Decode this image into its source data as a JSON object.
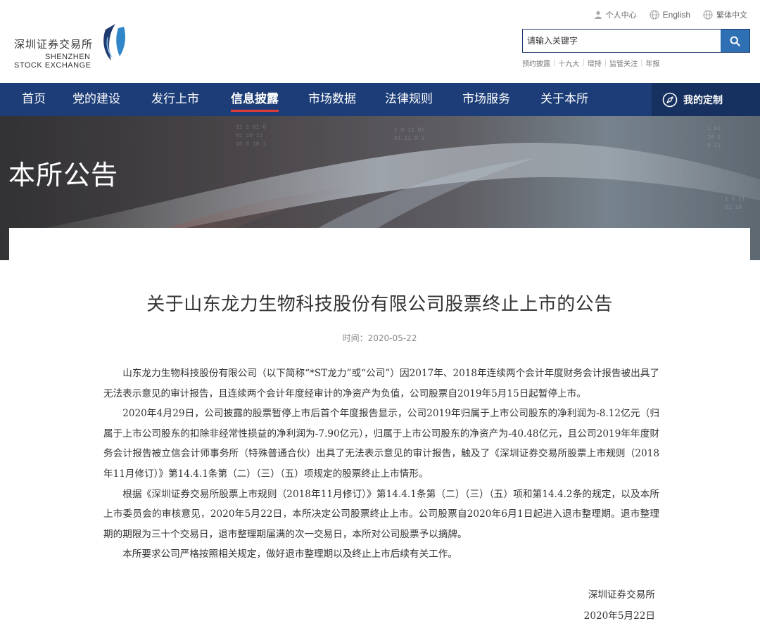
{
  "header": {
    "logo": {
      "cn": "深圳证券交易所",
      "en_line1": "SHENZHEN",
      "en_line2": "STOCK EXCHANGE"
    },
    "top_links": [
      {
        "label": "个人中心",
        "icon": "user-icon"
      },
      {
        "label": "English",
        "icon": "globe-icon"
      },
      {
        "label": "繁体中文",
        "icon": "globe-icon"
      }
    ],
    "search": {
      "placeholder": "请输入关键字",
      "button_icon": "search-icon"
    },
    "hot_words": [
      "预约披露",
      "十九大",
      "增持",
      "监管关注",
      "年报"
    ]
  },
  "nav": {
    "items": [
      {
        "label": "首页",
        "active": false
      },
      {
        "label": "党的建设",
        "active": false
      },
      {
        "label": "发行上市",
        "active": false
      },
      {
        "label": "信息披露",
        "active": true
      },
      {
        "label": "市场数据",
        "active": false
      },
      {
        "label": "法律规则",
        "active": false
      },
      {
        "label": "市场服务",
        "active": false
      },
      {
        "label": "关于本所",
        "active": false
      }
    ],
    "custom": {
      "label": "我的定制",
      "icon": "compass-icon"
    }
  },
  "banner": {
    "title": "本所公告"
  },
  "article": {
    "title": "关于山东龙力生物科技股份有限公司股票终止上市的公告",
    "date_label": "时间：2020-05-22",
    "paragraphs": [
      "山东龙力生物科技股份有限公司（以下简称“*ST龙力”或“公司”）因2017年、2018年连续两个会计年度财务会计报告被出具了无法表示意见的审计报告，且连续两个会计年度经审计的净资产为负值，公司股票自2019年5月15日起暂停上市。",
      "2020年4月29日，公司披露的股票暂停上市后首个年度报告显示，公司2019年归属于上市公司股东的净利润为-8.12亿元（归属于上市公司股东的扣除非经常性损益的净利润为-7.90亿元），归属于上市公司股东的净资产为-40.48亿元，且公司2019年年度财务会计报告被立信会计师事务所（特殊普通合伙）出具了无法表示意见的审计报告，触及了《深圳证券交易所股票上市规则（2018年11月修订）》第14.4.1条第（二）（三）（五）项规定的股票终止上市情形。",
      "根据《深圳证券交易所股票上市规则（2018年11月修订）》第14.4.1条第（二）（三）（五）项和第14.4.2条的规定，以及本所上市委员会的审核意见，2020年5月22日，本所决定公司股票终止上市。公司股票自2020年6月1日起进入退市整理期。退市整理期的期限为三十个交易日，退市整理期届满的次一交易日，本所对公司股票予以摘牌。",
      "本所要求公司严格按照相关规定，做好退市整理期以及终止上市后续有关工作。"
    ],
    "signature": "深圳证券交易所",
    "sign_date": "2020年5月22日"
  },
  "colors": {
    "nav_bg": "#1c3d77",
    "accent_blue": "#2f6fb3",
    "active_underline": "#e33b3b"
  }
}
